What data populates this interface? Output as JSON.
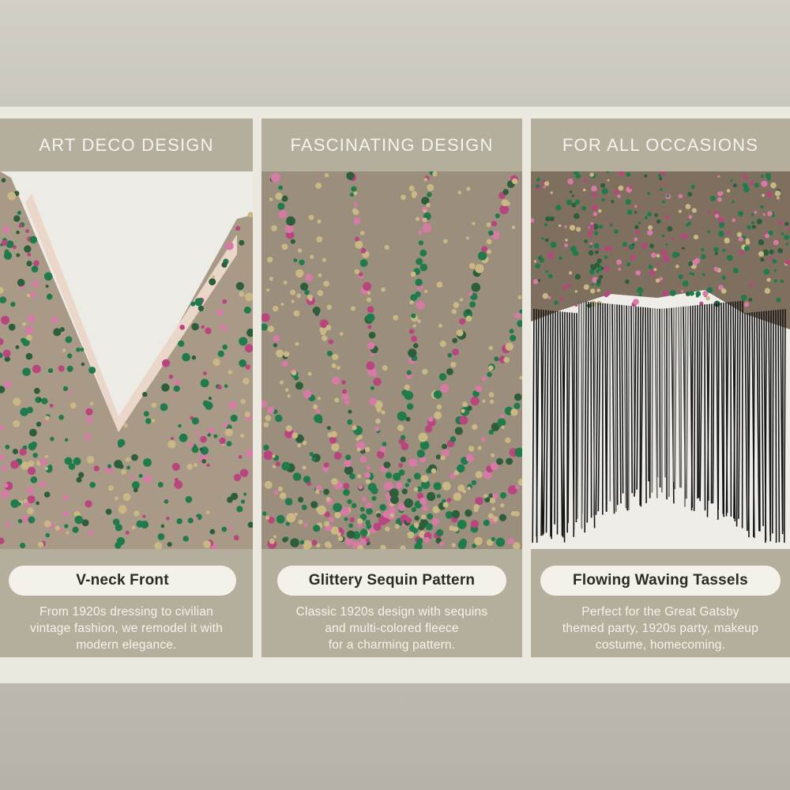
{
  "panels": [
    {
      "heading": "ART DECO DESIGN",
      "feature": "V-neck Front",
      "description_lines": [
        "From 1920s dressing to civilian",
        "vintage fashion, we remodel it with",
        "modern elegance."
      ]
    },
    {
      "heading": "FASCINATING DESIGN",
      "feature": "Glittery Sequin Pattern",
      "description_lines": [
        "Classic 1920s design with sequins",
        "and multi-colored fleece",
        "for a charming pattern."
      ]
    },
    {
      "heading": "FOR ALL OCCASIONS",
      "feature": "Flowing Waving Tassels",
      "description_lines": [
        "Perfect for the Great Gatsby",
        "themed party, 1920s party, makeup",
        "costume, homecoming."
      ]
    }
  ],
  "colors": {
    "panel": "#b4ae9d",
    "band": "#eae8df",
    "sequin_green": "#1f7a4c",
    "sequin_magenta": "#b8457e",
    "sequin_gold": "#c9b784",
    "fringe": "#151515"
  }
}
